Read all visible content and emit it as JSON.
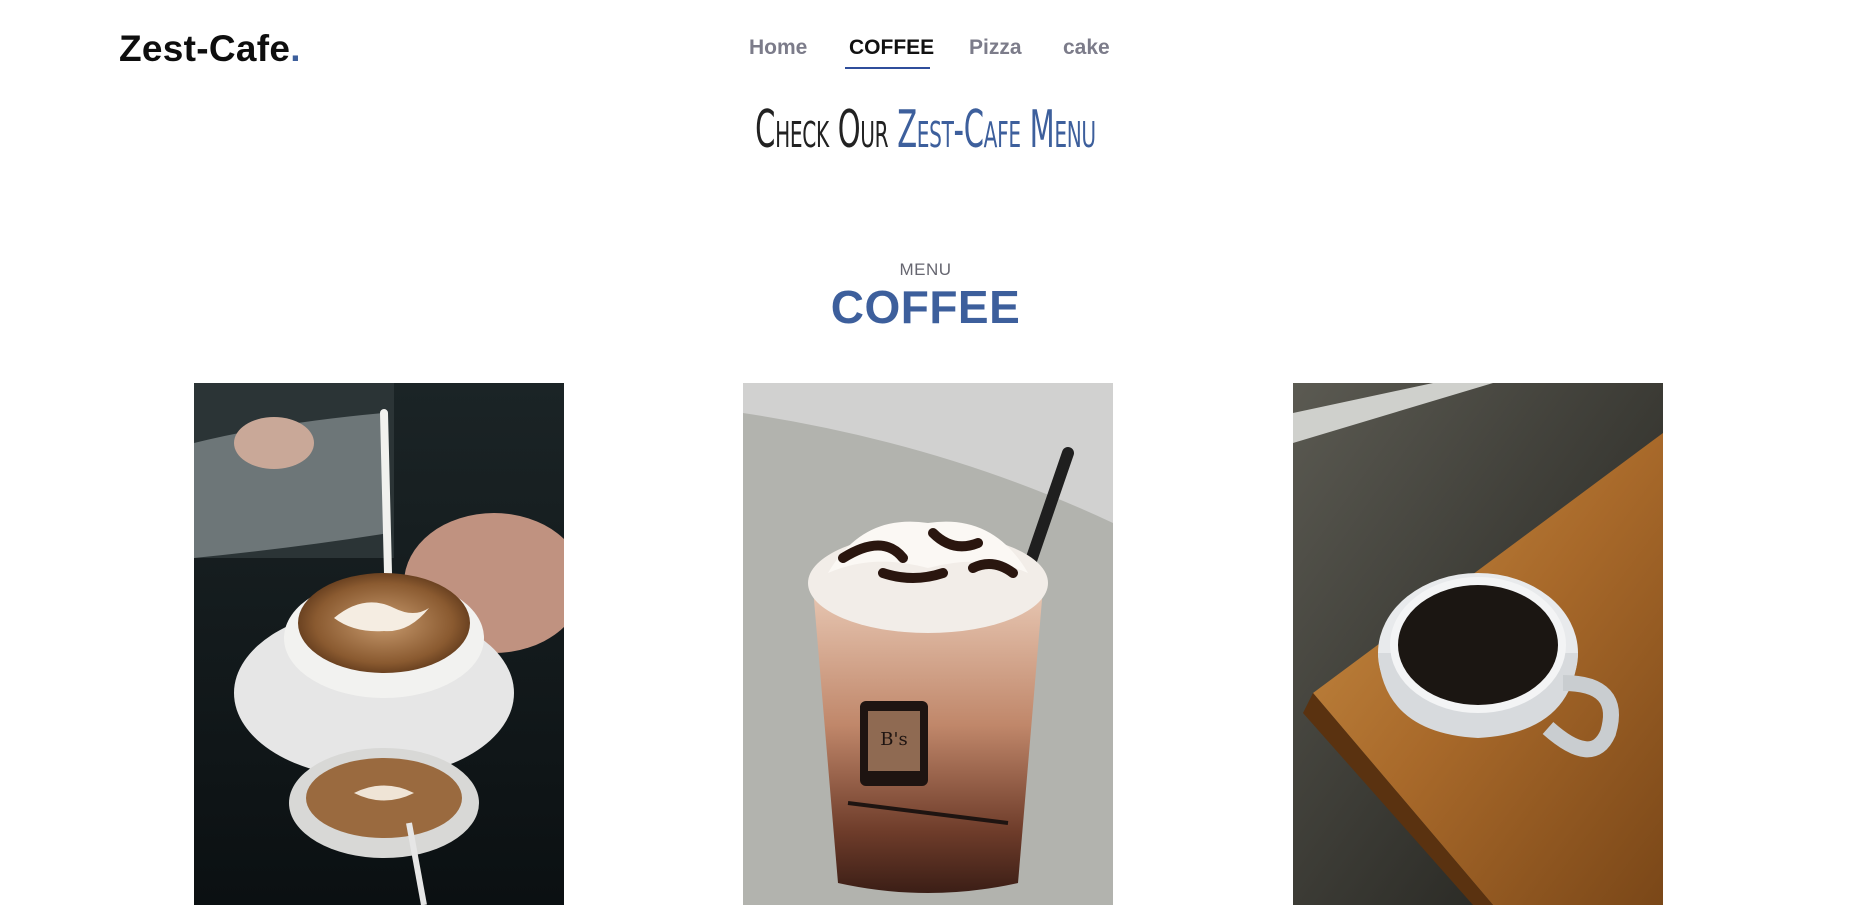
{
  "brand": {
    "name": "Zest-Cafe",
    "dot": "."
  },
  "nav": {
    "items": [
      {
        "label": "Home"
      },
      {
        "label": "COFFEE",
        "active": true
      },
      {
        "label": "Pizza"
      },
      {
        "label": "cake"
      }
    ]
  },
  "hero": {
    "prefix": "Check Our ",
    "accent": "Zest-Cafe Menu"
  },
  "section": {
    "eyebrow": "MENU",
    "title": "COFFEE"
  },
  "products": [
    {
      "image": "latte-art-photo"
    },
    {
      "image": "iced-mocha-photo"
    },
    {
      "image": "black-coffee-cup-photo"
    }
  ],
  "colors": {
    "accent": "#3d5f9c",
    "nav_underline": "#2f4e9b",
    "text_dark": "#0e0e0e",
    "nav_muted": "#7c7c8a"
  }
}
